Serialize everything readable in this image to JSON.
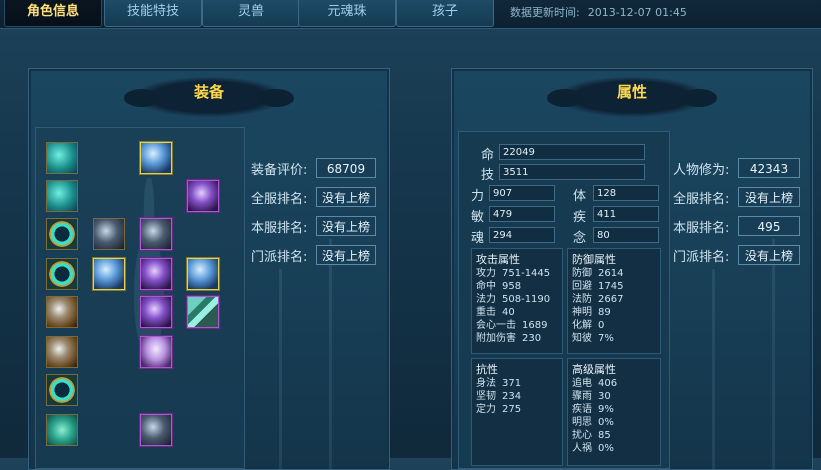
{
  "tabs": [
    {
      "label": "角色信息",
      "active": true
    },
    {
      "label": "技能特技",
      "active": false
    },
    {
      "label": "灵兽",
      "active": false
    },
    {
      "label": "元魂珠",
      "active": false
    },
    {
      "label": "孩子",
      "active": false
    }
  ],
  "update": {
    "label": "数据更新时间:",
    "value": "2013-12-07 01:45"
  },
  "equipment": {
    "title": "装备",
    "slots": [
      {
        "icon": "helmet-icon",
        "quality": "brown"
      },
      {
        "icon": "blue-weapon-icon",
        "quality": "gold"
      },
      {
        "icon": "armor-icon",
        "quality": "brown"
      },
      {
        "icon": "purple-orb-icon",
        "quality": "purple"
      },
      {
        "icon": "ring-icon",
        "quality": "brown"
      },
      {
        "icon": "dark-blade-icon",
        "quality": "brown"
      },
      {
        "icon": "shoulder-icon",
        "quality": "purple"
      },
      {
        "icon": "ring-icon",
        "quality": "brown"
      },
      {
        "icon": "blue-feather-icon",
        "quality": "gold"
      },
      {
        "icon": "purple-gem-icon",
        "quality": "purple"
      },
      {
        "icon": "silver-wing-icon",
        "quality": "gold"
      },
      {
        "icon": "bracer-icon",
        "quality": "brown"
      },
      {
        "icon": "purple-beast-icon",
        "quality": "purple"
      },
      {
        "icon": "jade-blade-icon",
        "quality": "purple"
      },
      {
        "icon": "boots-icon",
        "quality": "brown"
      },
      {
        "icon": "pants-icon",
        "quality": "purple"
      },
      {
        "icon": "jade-ring-icon",
        "quality": "brown"
      },
      {
        "icon": "jade-pendant-icon",
        "quality": "brown"
      },
      {
        "icon": "dark-armor-icon",
        "quality": "purple"
      }
    ],
    "ranks": [
      {
        "label": "装备评价:",
        "value": "68709"
      },
      {
        "label": "全服排名:",
        "value": "没有上榜"
      },
      {
        "label": "本服排名:",
        "value": "没有上榜"
      },
      {
        "label": "门派排名:",
        "value": "没有上榜"
      }
    ]
  },
  "attributes": {
    "title": "属性",
    "ming": {
      "label": "命",
      "value": "22049"
    },
    "ji": {
      "label": "技",
      "value": "3511"
    },
    "base": [
      {
        "label": "力",
        "value": "907"
      },
      {
        "label": "体",
        "value": "128"
      },
      {
        "label": "敏",
        "value": "479"
      },
      {
        "label": "疾",
        "value": "411"
      },
      {
        "label": "魂",
        "value": "294"
      },
      {
        "label": "念",
        "value": "80"
      }
    ],
    "attack": {
      "title": "攻击属性",
      "rows": [
        {
          "k": "攻力",
          "v": "751-1445"
        },
        {
          "k": "命中",
          "v": "958"
        },
        {
          "k": "法力",
          "v": "508-1190"
        },
        {
          "k": "重击",
          "v": "40"
        },
        {
          "k": "会心一击",
          "v": "1689"
        },
        {
          "k": "附加伤害",
          "v": "230"
        }
      ]
    },
    "defense": {
      "title": "防御属性",
      "rows": [
        {
          "k": "防御",
          "v": "2614"
        },
        {
          "k": "回避",
          "v": "1745"
        },
        {
          "k": "法防",
          "v": "2667"
        },
        {
          "k": "神明",
          "v": "89"
        },
        {
          "k": "化解",
          "v": "0"
        },
        {
          "k": "知彼",
          "v": "7%"
        }
      ]
    },
    "resist": {
      "title": "抗性",
      "rows": [
        {
          "k": "身法",
          "v": "371"
        },
        {
          "k": "坚韧",
          "v": "234"
        },
        {
          "k": "定力",
          "v": "275"
        }
      ]
    },
    "advanced": {
      "title": "高级属性",
      "rows": [
        {
          "k": "追电",
          "v": "406"
        },
        {
          "k": "骤雨",
          "v": "30"
        },
        {
          "k": "疾语",
          "v": "9%"
        },
        {
          "k": "明思",
          "v": "0%"
        },
        {
          "k": "扰心",
          "v": "85"
        },
        {
          "k": "人祸",
          "v": "0%"
        }
      ]
    },
    "ranks": [
      {
        "label": "人物修为:",
        "value": "42343"
      },
      {
        "label": "全服排名:",
        "value": "没有上榜"
      },
      {
        "label": "本服排名:",
        "value": "495"
      },
      {
        "label": "门派排名:",
        "value": "没有上榜"
      }
    ]
  }
}
